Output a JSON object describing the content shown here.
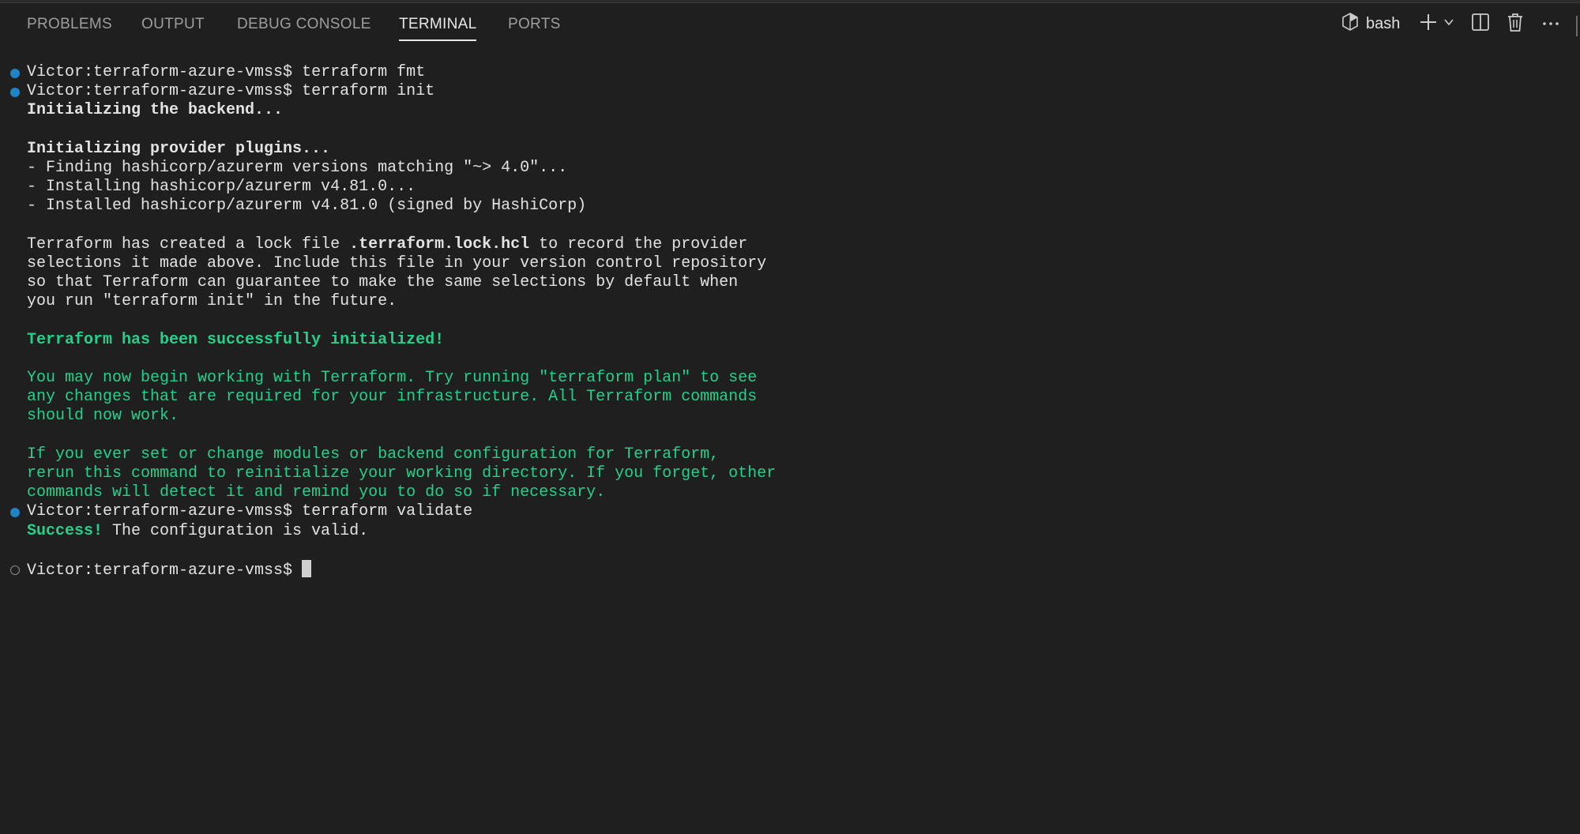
{
  "tabs": [
    {
      "label": "PROBLEMS",
      "active": false
    },
    {
      "label": "OUTPUT",
      "active": false
    },
    {
      "label": "DEBUG CONSOLE",
      "active": false
    },
    {
      "label": "TERMINAL",
      "active": true
    },
    {
      "label": "PORTS",
      "active": false
    }
  ],
  "toolbar": {
    "shell_label": "bash",
    "icons": [
      "terminal-shell-icon",
      "plus-icon",
      "chevron-down-icon",
      "split-terminal-icon",
      "trash-icon",
      "ellipsis-icon"
    ]
  },
  "colors": {
    "background": "#1f1f1f",
    "success_green": "#23d18b",
    "prompt_dot_blue": "#1f83c4",
    "text": "#e3e3e3"
  },
  "terminal": {
    "prompt": "Victor:terraform-azure-vmss$",
    "cmd_fmt": "terraform fmt",
    "cmd_init": "terraform init",
    "init_backend": "Initializing the backend...",
    "init_plugins": "Initializing provider plugins...",
    "find_line": "- Finding hashicorp/azurerm versions matching \"~> 4.0\"...",
    "installing_line": "- Installing hashicorp/azurerm v4.81.0...",
    "installed_line": "- Installed hashicorp/azurerm v4.81.0 (signed by HashiCorp)",
    "lock_1a": "Terraform has created a lock file ",
    "lock_1b": ".terraform.lock.hcl",
    "lock_1c": " to record the provider",
    "lock_2": "selections it made above. Include this file in your version control repository",
    "lock_3": "so that Terraform can guarantee to make the same selections by default when",
    "lock_4": "you run \"terraform init\" in the future.",
    "success_init": "Terraform has been successfully initialized!",
    "begin_1": "You may now begin working with Terraform. Try running \"terraform plan\" to see",
    "begin_2": "any changes that are required for your infrastructure. All Terraform commands",
    "begin_3": "should now work.",
    "modules_1": "If you ever set or change modules or backend configuration for Terraform,",
    "modules_2": "rerun this command to reinitialize your working directory. If you forget, other",
    "modules_3": "commands will detect it and remind you to do so if necessary.",
    "cmd_validate": "terraform validate",
    "validate_success": "Success!",
    "validate_rest": " The configuration is valid."
  }
}
